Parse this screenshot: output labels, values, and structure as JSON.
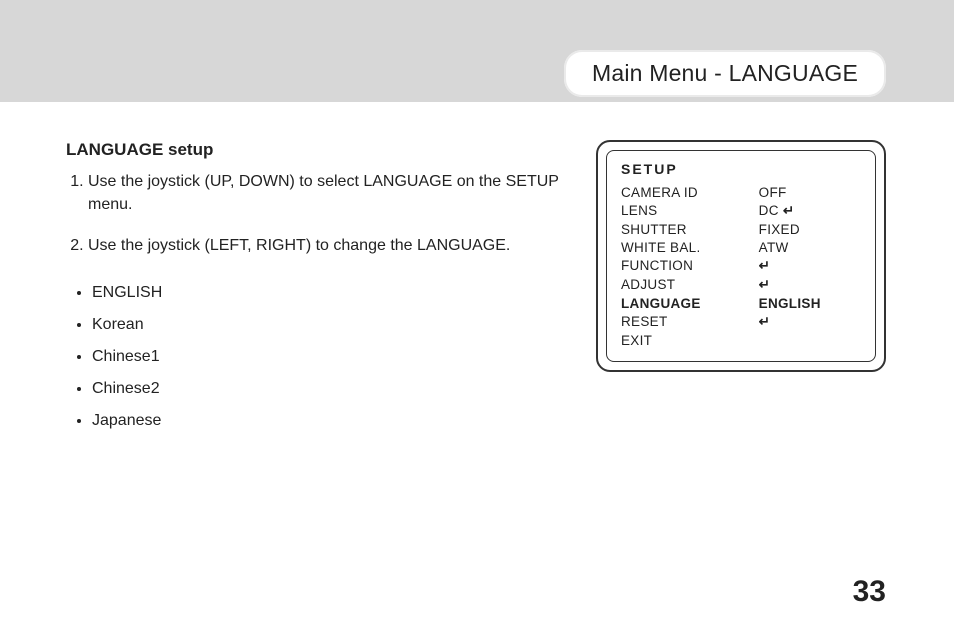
{
  "header": {
    "title": "Main Menu - LANGUAGE"
  },
  "section": {
    "title": "LANGUAGE setup"
  },
  "steps": [
    "Use the joystick (UP, DOWN) to select LANGUAGE on the SETUP menu.",
    "Use the joystick (LEFT, RIGHT) to change the LANGUAGE."
  ],
  "languages": [
    "ENGLISH",
    "Korean",
    "Chinese1",
    "Chinese2",
    "Japanese"
  ],
  "osd": {
    "title": "SETUP",
    "rows": [
      {
        "label": "CAMERA ID",
        "value": "OFF",
        "enter": false,
        "bold": false
      },
      {
        "label": "LENS",
        "value": "DC",
        "enter": true,
        "bold": false
      },
      {
        "label": "SHUTTER",
        "value": "FIXED",
        "enter": false,
        "bold": false
      },
      {
        "label": "WHITE BAL.",
        "value": "ATW",
        "enter": false,
        "bold": false
      },
      {
        "label": "FUNCTION",
        "value": "",
        "enter": true,
        "bold": false
      },
      {
        "label": "ADJUST",
        "value": "",
        "enter": true,
        "bold": false
      },
      {
        "label": "LANGUAGE",
        "value": "ENGLISH",
        "enter": false,
        "bold": true
      },
      {
        "label": "RESET",
        "value": "",
        "enter": true,
        "bold": false
      },
      {
        "label": "EXIT",
        "value": "",
        "enter": false,
        "bold": false
      }
    ]
  },
  "glyphs": {
    "enter": "↵"
  },
  "page_number": "33"
}
